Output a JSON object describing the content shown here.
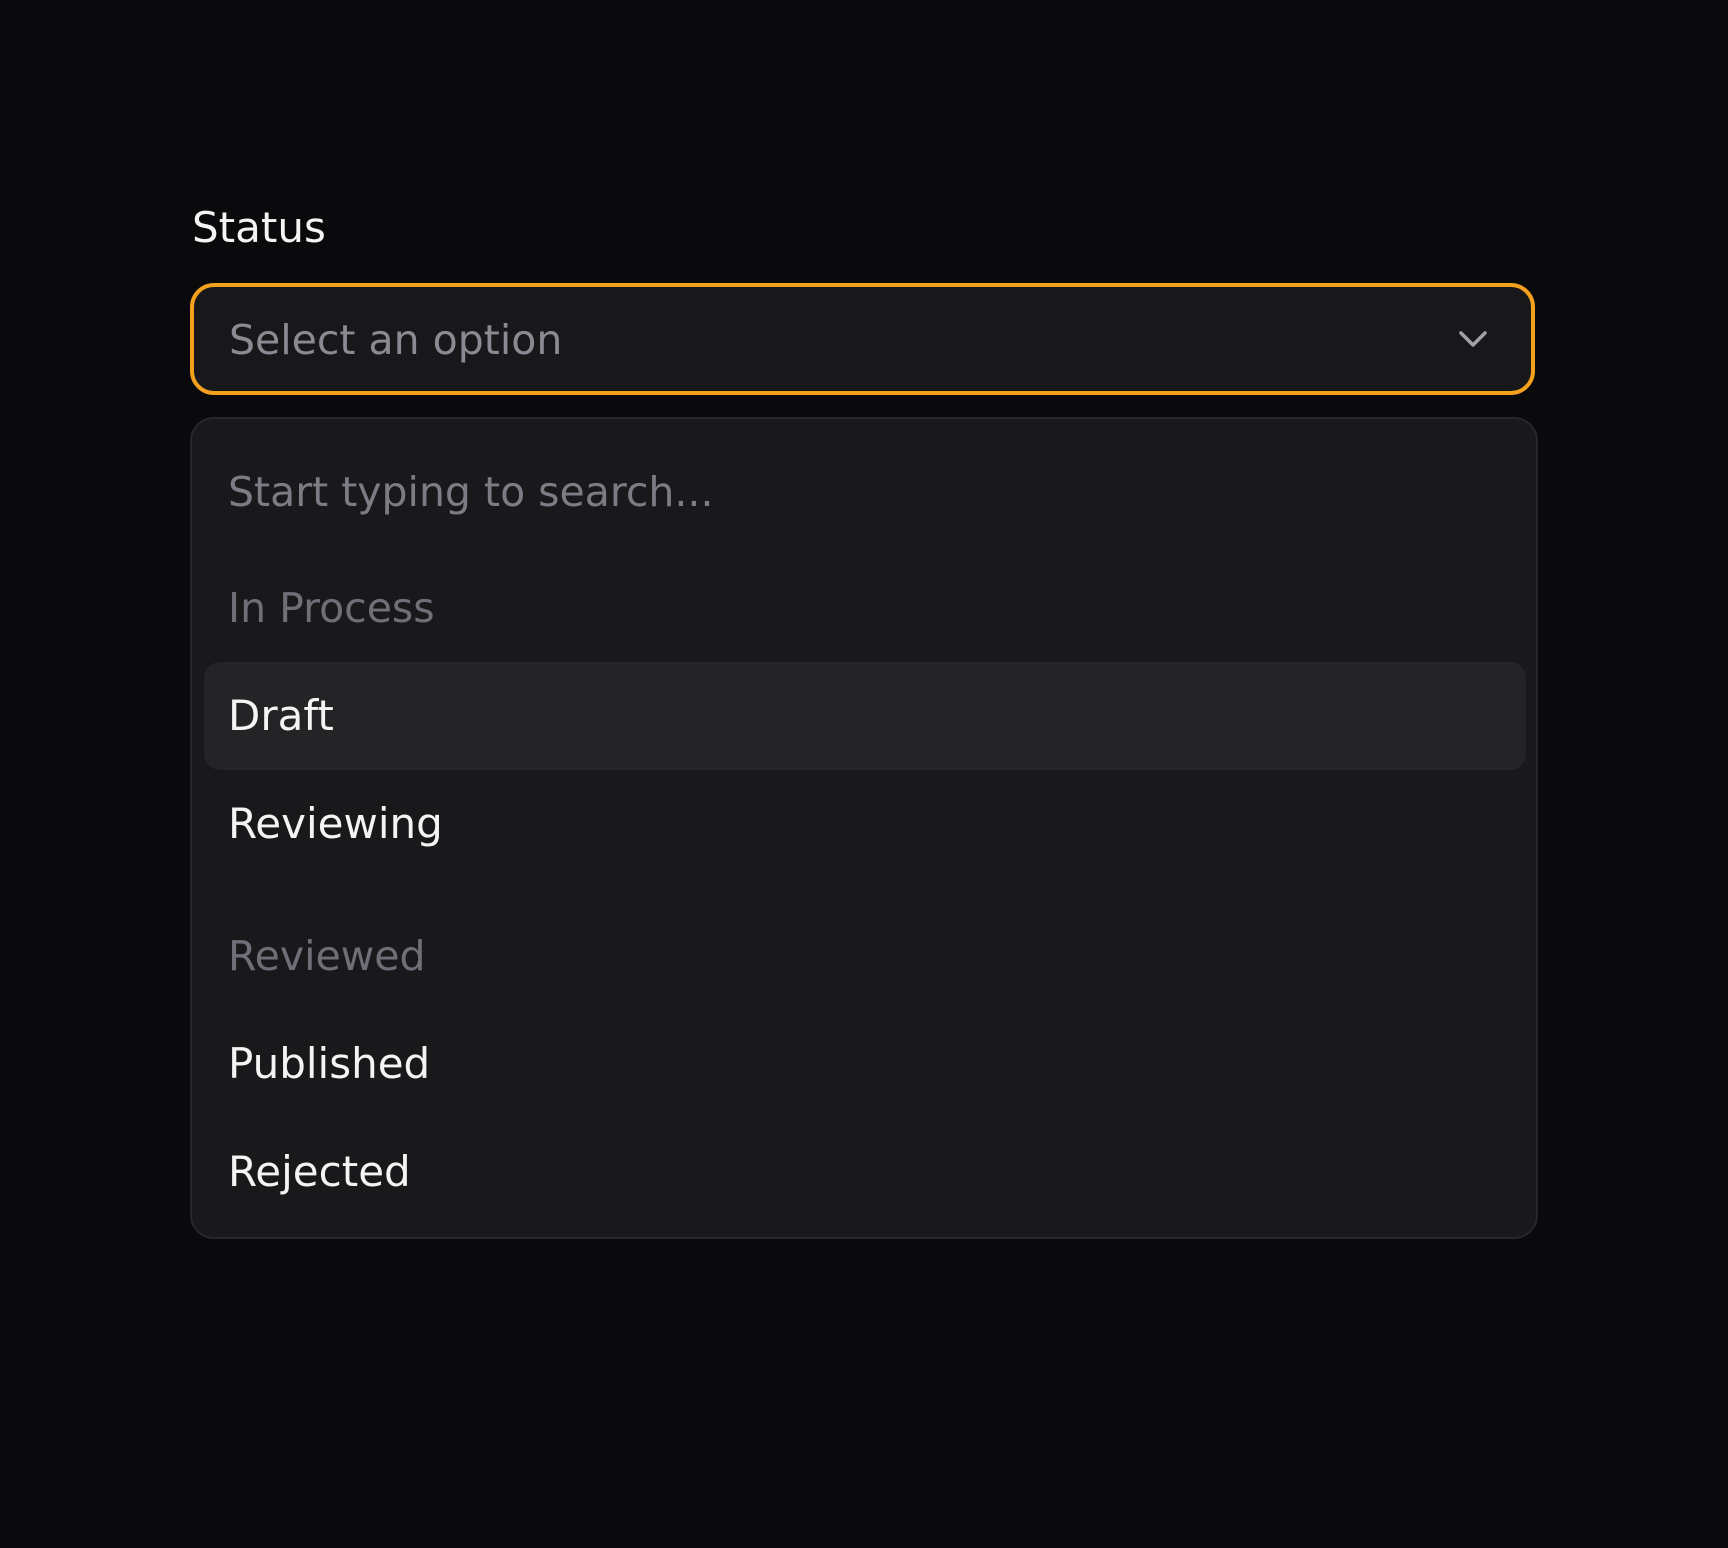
{
  "field": {
    "label": "Status",
    "placeholder": "Select an option",
    "chevron_icon": "chevron-down-icon"
  },
  "dropdown": {
    "search_placeholder": "Start typing to search...",
    "groups": [
      {
        "label": "In Process",
        "options": [
          {
            "label": "Draft",
            "highlighted": true
          },
          {
            "label": "Reviewing",
            "highlighted": false
          }
        ]
      },
      {
        "label": "Reviewed",
        "options": [
          {
            "label": "Published",
            "highlighted": false
          },
          {
            "label": "Rejected",
            "highlighted": false
          }
        ]
      }
    ]
  },
  "colors": {
    "background": "#0a0a0d",
    "focus_ring": "#f5a01d",
    "trigger_bg": "#18181b",
    "dropdown_bg": "#19191c",
    "highlight_bg": "#242427",
    "text_primary": "#f4f4f5",
    "text_placeholder": "#8a8a93",
    "text_group": "#6f6f78"
  }
}
